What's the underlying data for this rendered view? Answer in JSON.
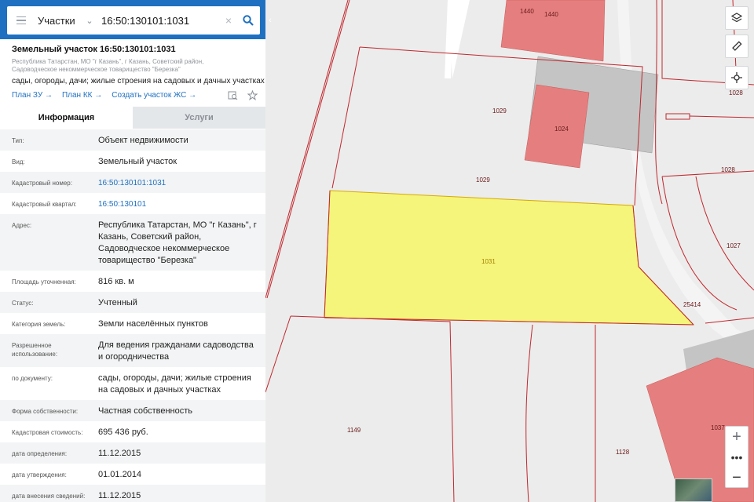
{
  "search": {
    "category": "Участки",
    "query": "16:50:130101:1031"
  },
  "card": {
    "title": "Земельный участок 16:50:130101:1031",
    "address_line1": "Республика Татарстан, МО \"г Казань\", г Казань, Советский район,",
    "address_line2": "Садоводческое некоммерческое товарищество \"Березка\"",
    "purpose": "сады, огороды, дачи; жилые строения на садовых и дачных участках",
    "links": [
      "План ЗУ",
      "План КК",
      "Создать участок ЖС"
    ]
  },
  "tabs": {
    "info": "Информация",
    "services": "Услуги"
  },
  "rows": [
    {
      "label": "Тип:",
      "value": "Объект недвижимости"
    },
    {
      "label": "Вид:",
      "value": "Земельный участок"
    },
    {
      "label": "Кадастровый номер:",
      "value": "16:50:130101:1031"
    },
    {
      "label": "Кадастровый квартал:",
      "value": "16:50:130101"
    },
    {
      "label": "Адрес:",
      "value": "Республика Татарстан, МО \"г Казань\", г Казань, Советский район, Садоводческое некоммерческое товарищество \"Березка\""
    },
    {
      "label": "Площадь уточненная:",
      "value": "816 кв. м"
    },
    {
      "label": "Статус:",
      "value": "Учтенный"
    },
    {
      "label": "Категория земель:",
      "value": "Земли населённых пунктов"
    },
    {
      "label": "Разрешенное использование:",
      "value": "Для ведения гражданами садоводства и огородничества"
    },
    {
      "label": "по документу:",
      "value": "сады, огороды, дачи; жилые строения на садовых и дачных участках"
    },
    {
      "label": "Форма собственности:",
      "value": "Частная собственность"
    },
    {
      "label": "Кадастровая стоимость:",
      "value": "695 436 руб."
    },
    {
      "label": "дата определения:",
      "value": "11.12.2015"
    },
    {
      "label": "дата утверждения:",
      "value": "01.01.2014"
    },
    {
      "label": "дата внесения сведений:",
      "value": "11.12.2015"
    }
  ],
  "map_labels": {
    "p1440a": "1440",
    "p1440b": "1440",
    "p1029a": "1029",
    "p1024": "1024",
    "p1028a": "1028",
    "p1029b": "1029",
    "p1028b": "1028",
    "p1031": "1031",
    "p1027": "1027",
    "p25414": "25414",
    "p1149": "1149",
    "p1128": "1128",
    "p1037": "1037"
  },
  "colors": {
    "accent": "#1f70c1",
    "selected_parcel": "#f6f57b",
    "building": "#e57f7f",
    "boundary": "#c1272d"
  },
  "icons": [
    "menu-icon",
    "chevron-down-icon",
    "clear-icon",
    "search-icon",
    "collapse-panel-icon",
    "arrow-right-icon",
    "print-icon",
    "star-icon",
    "layers-icon",
    "ruler-icon",
    "locate-icon",
    "zoom-in-icon",
    "more-icon",
    "zoom-out-icon"
  ]
}
